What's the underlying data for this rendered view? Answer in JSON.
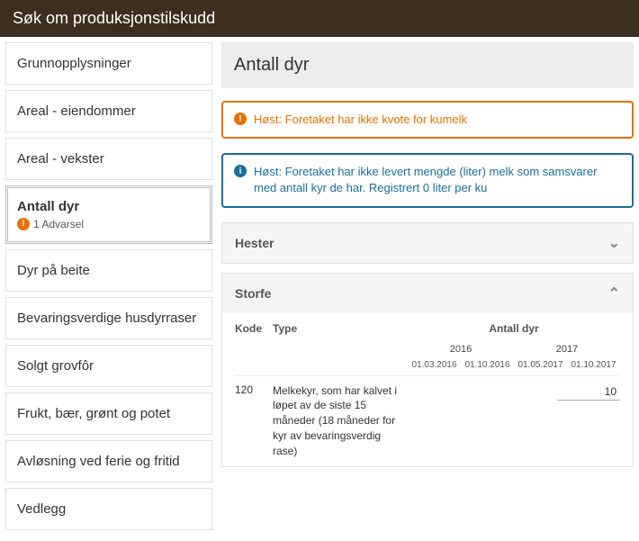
{
  "header": {
    "title": "Søk om produksjonstilskudd"
  },
  "sidebar": {
    "items": [
      {
        "label": "Grunnopplysninger"
      },
      {
        "label": "Areal - eiendommer"
      },
      {
        "label": "Areal - vekster"
      },
      {
        "label": "Antall dyr",
        "warning_count": "1 Advarsel"
      },
      {
        "label": "Dyr på beite"
      },
      {
        "label": "Bevaringsverdige husdyrraser"
      },
      {
        "label": "Solgt grovfôr"
      },
      {
        "label": "Frukt, bær, grønt og potet"
      },
      {
        "label": "Avløsning ved ferie og fritid"
      },
      {
        "label": "Vedlegg"
      }
    ]
  },
  "main": {
    "title": "Antall dyr",
    "alerts": [
      {
        "type": "warn",
        "text": "Høst: Foretaket har ikke kvote for kumelk"
      },
      {
        "type": "info",
        "text": "Høst: Foretaket har ikke levert mengde (liter) melk som samsvarer med antall kyr de har. Registrert 0 liter per ku"
      }
    ],
    "sections": {
      "hester": {
        "title": "Hester"
      },
      "storfe": {
        "title": "Storfe",
        "columns": {
          "kode": "Kode",
          "type": "Type",
          "antall": "Antall dyr"
        },
        "years": [
          "2016",
          "2017"
        ],
        "dates": [
          "01.03.2016",
          "01.10.2016",
          "01.05.2017",
          "01.10.2017"
        ],
        "rows": [
          {
            "kode": "120",
            "type": "Melkekyr, som har kalvet i løpet av de siste 15 måneder (18 måneder for kyr av bevaringsverdig rase)",
            "value_last": "10"
          }
        ]
      }
    }
  }
}
